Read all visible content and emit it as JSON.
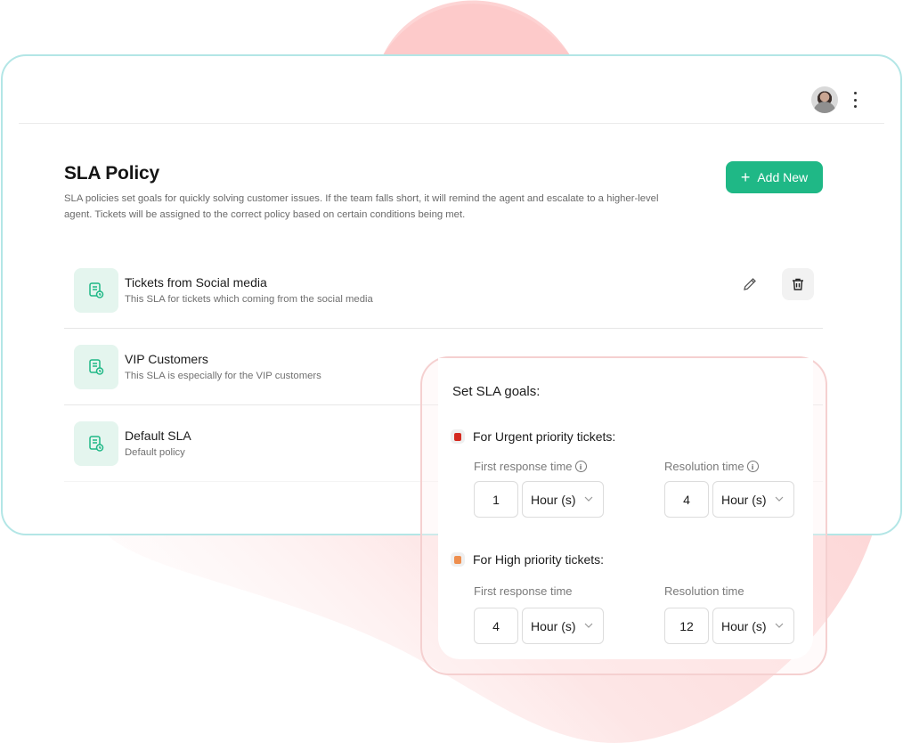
{
  "header": {
    "avatar_alt": "user-avatar",
    "menu_icon": "more-vertical-icon"
  },
  "page": {
    "title": "SLA Policy",
    "description": "SLA policies set goals for quickly solving customer issues. If the team falls short, it will remind the agent and escalate to a higher-level agent. Tickets will be assigned to the correct policy based on certain conditions being met.",
    "add_button_label": "Add New",
    "add_button_icon": "plus-icon"
  },
  "policies": [
    {
      "name": "Tickets from Social media",
      "description": "This SLA for tickets which coming from the social media",
      "icon": "document-clock-icon",
      "actions": [
        "edit-icon",
        "trash-icon"
      ]
    },
    {
      "name": "VIP Customers",
      "description": "This SLA is especially for the VIP customers",
      "icon": "document-clock-icon"
    },
    {
      "name": "Default SLA",
      "description": "Default policy",
      "icon": "document-clock-icon"
    }
  ],
  "goals": {
    "title": "Set SLA goals:",
    "priorities": [
      {
        "label": "For Urgent priority tickets:",
        "color": "#d42a20",
        "first_response": {
          "label": "First response time",
          "value": "1",
          "unit": "Hour (s)",
          "info": true
        },
        "resolution": {
          "label": "Resolution time",
          "value": "4",
          "unit": "Hour (s)",
          "info": true
        }
      },
      {
        "label": "For High priority tickets:",
        "color": "#ee8e4e",
        "first_response": {
          "label": "First response time",
          "value": "4",
          "unit": "Hour (s)",
          "info": false
        },
        "resolution": {
          "label": "Resolution time",
          "value": "12",
          "unit": "Hour (s)",
          "info": false
        }
      }
    ]
  },
  "colors": {
    "accent": "#1fb886",
    "card_border": "#b3e6e6",
    "goals_border": "#f5d0d0",
    "blob": "#fdcaca"
  }
}
